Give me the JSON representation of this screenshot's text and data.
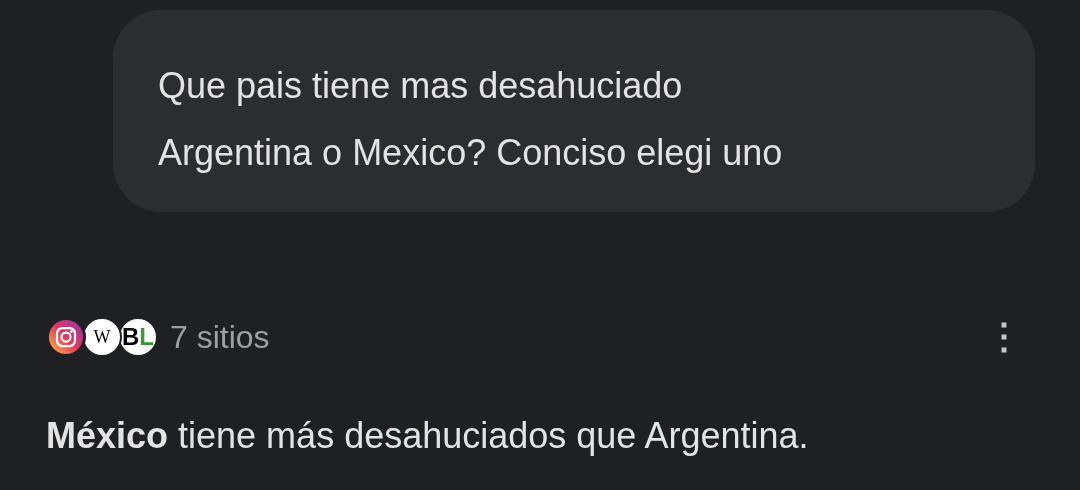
{
  "question": {
    "lines": [
      "Que pais tiene mas desahuciado",
      "Argentina o Mexico? Conciso elegi uno"
    ]
  },
  "sources": {
    "icons": [
      {
        "kind": "instagram"
      },
      {
        "kind": "letter",
        "letters": [
          "W"
        ]
      },
      {
        "kind": "duo",
        "letters": [
          "B",
          "L"
        ]
      }
    ],
    "count": "7 sitios",
    "menu": "⋮"
  },
  "answer": "**México** tiene más desahuciados que Argentina."
}
